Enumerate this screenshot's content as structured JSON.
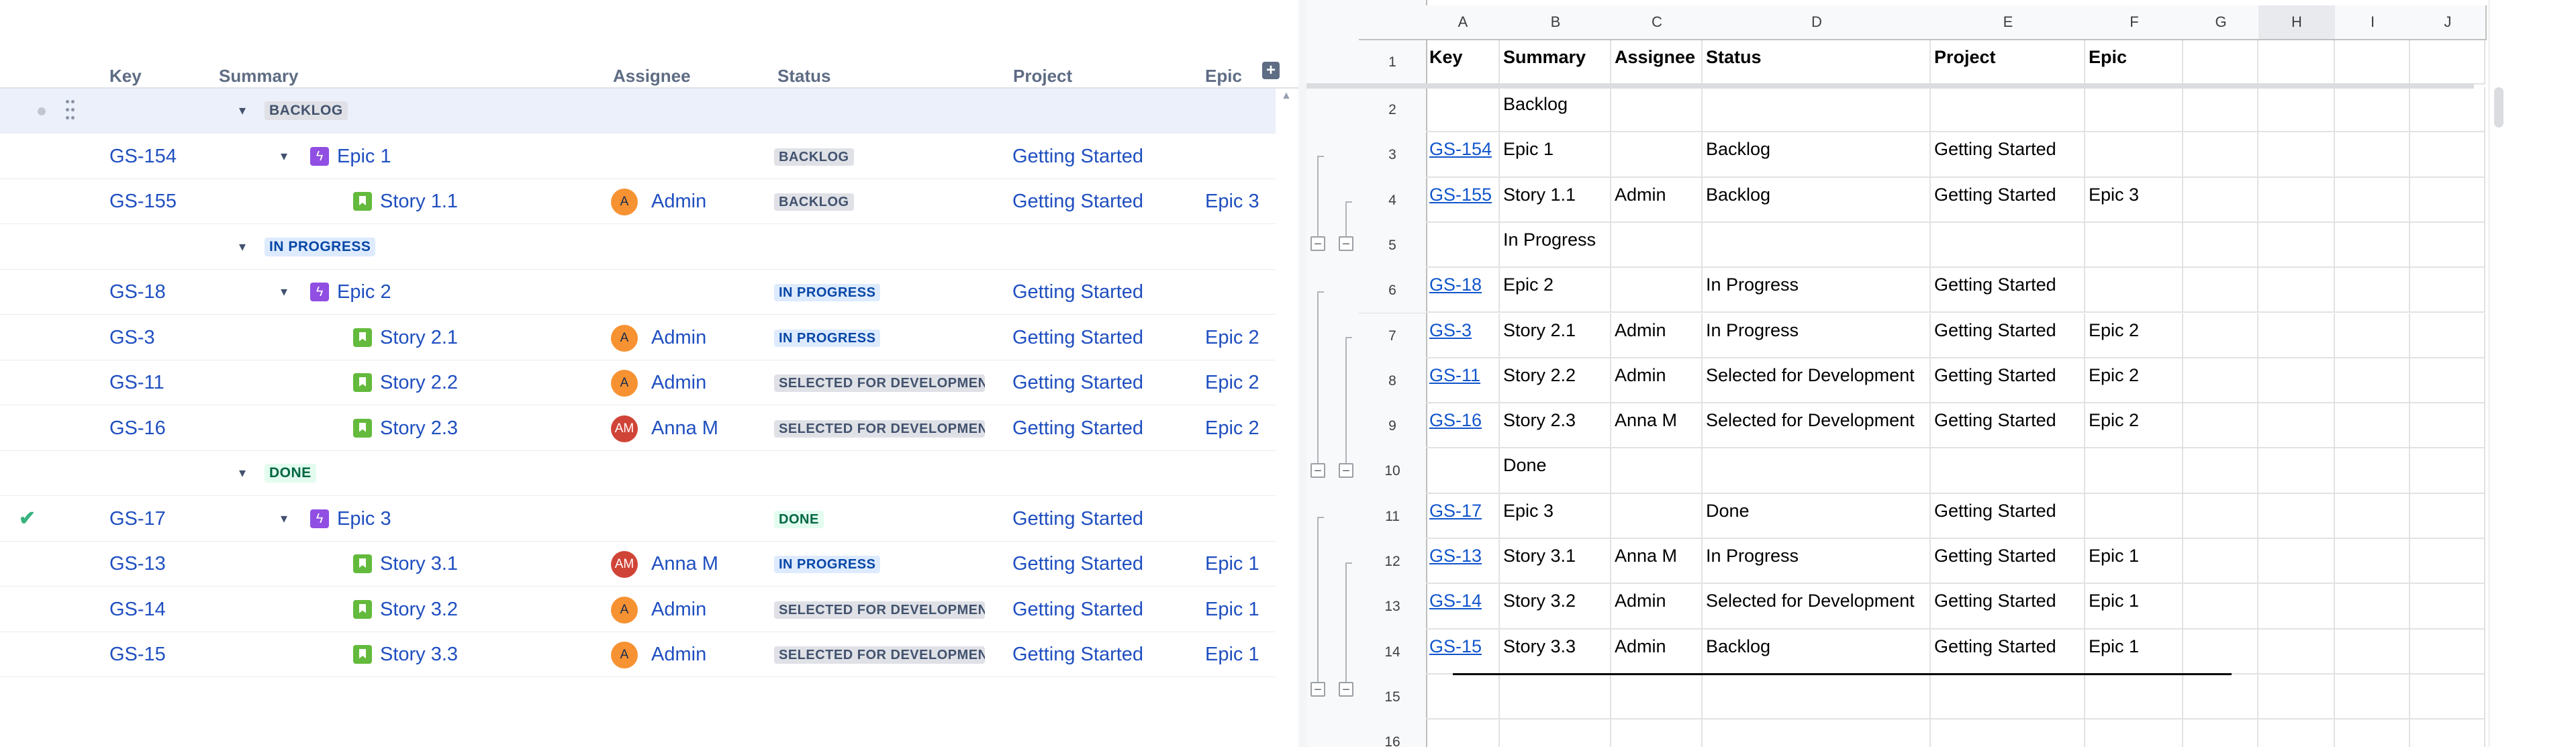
{
  "structure": {
    "columns": [
      "Key",
      "Summary",
      "Assignee",
      "Status",
      "Project",
      "Epic"
    ],
    "add_column_label": "+",
    "rows": [
      {
        "type": "group",
        "label": "BACKLOG",
        "color": "grey",
        "selected": true
      },
      {
        "type": "issue",
        "key": "GS-154",
        "issuetype": "epic",
        "expand": true,
        "summary": "Epic 1",
        "assignee": "",
        "avatar": "",
        "status": "BACKLOG",
        "status_color": "grey",
        "project": "Getting Started",
        "epic": ""
      },
      {
        "type": "issue",
        "key": "GS-155",
        "issuetype": "story",
        "expand": false,
        "summary": "Story 1.1",
        "assignee": "Admin",
        "avatar": "A",
        "status": "BACKLOG",
        "status_color": "grey",
        "project": "Getting Started",
        "epic": "Epic 3"
      },
      {
        "type": "group",
        "label": "IN PROGRESS",
        "color": "blue"
      },
      {
        "type": "issue",
        "key": "GS-18",
        "issuetype": "epic",
        "expand": true,
        "summary": "Epic 2",
        "assignee": "",
        "avatar": "",
        "status": "IN PROGRESS",
        "status_color": "blue",
        "project": "Getting Started",
        "epic": ""
      },
      {
        "type": "issue",
        "key": "GS-3",
        "issuetype": "story",
        "expand": false,
        "summary": "Story 2.1",
        "assignee": "Admin",
        "avatar": "A",
        "status": "IN PROGRESS",
        "status_color": "blue",
        "project": "Getting Started",
        "epic": "Epic 2"
      },
      {
        "type": "issue",
        "key": "GS-11",
        "issuetype": "story",
        "expand": false,
        "summary": "Story 2.2",
        "assignee": "Admin",
        "avatar": "A",
        "status": "SELECTED FOR DEVELOPMENT",
        "status_color": "grey",
        "project": "Getting Started",
        "epic": "Epic 2"
      },
      {
        "type": "issue",
        "key": "GS-16",
        "issuetype": "story",
        "expand": false,
        "summary": "Story 2.3",
        "assignee": "Anna M",
        "avatar": "AM",
        "status": "SELECTED FOR DEVELOPMENT",
        "status_color": "grey",
        "project": "Getting Started",
        "epic": "Epic 2"
      },
      {
        "type": "group",
        "label": "DONE",
        "color": "green"
      },
      {
        "type": "issue",
        "key": "GS-17",
        "issuetype": "epic",
        "expand": true,
        "resolved": true,
        "summary": "Epic 3",
        "assignee": "",
        "avatar": "",
        "status": "DONE",
        "status_color": "green",
        "project": "Getting Started",
        "epic": ""
      },
      {
        "type": "issue",
        "key": "GS-13",
        "issuetype": "story",
        "expand": false,
        "summary": "Story 3.1",
        "assignee": "Anna M",
        "avatar": "AM",
        "status": "IN PROGRESS",
        "status_color": "blue",
        "project": "Getting Started",
        "epic": "Epic 1"
      },
      {
        "type": "issue",
        "key": "GS-14",
        "issuetype": "story",
        "expand": false,
        "summary": "Story 3.2",
        "assignee": "Admin",
        "avatar": "A",
        "status": "SELECTED FOR DEVELOPMENT",
        "status_color": "grey",
        "project": "Getting Started",
        "epic": "Epic 1"
      },
      {
        "type": "issue",
        "key": "GS-15",
        "issuetype": "story",
        "expand": false,
        "summary": "Story 3.3",
        "assignee": "Admin",
        "avatar": "A",
        "status": "SELECTED FOR DEVELOPMENT",
        "status_color": "grey",
        "project": "Getting Started",
        "epic": "Epic 1"
      }
    ]
  },
  "sheet": {
    "column_letters": [
      "A",
      "B",
      "C",
      "D",
      "E",
      "F",
      "G",
      "H",
      "I",
      "J"
    ],
    "highlighted_column": "H",
    "row_numbers": [
      "1",
      "2",
      "3",
      "4",
      "5",
      "6",
      "7",
      "8",
      "9",
      "10",
      "11",
      "12",
      "13",
      "14",
      "15",
      "16"
    ],
    "rows": [
      [
        "Key",
        "Summary",
        "Assignee",
        "Status",
        "Project",
        "Epic"
      ],
      [
        "",
        "Backlog",
        "",
        "",
        "",
        ""
      ],
      [
        "GS-154",
        "Epic 1",
        "",
        "Backlog",
        "Getting Started",
        ""
      ],
      [
        "GS-155",
        "Story 1.1",
        "Admin",
        "Backlog",
        "Getting Started",
        "Epic 3"
      ],
      [
        "",
        "In Progress",
        "",
        "",
        "",
        ""
      ],
      [
        "GS-18",
        "Epic 2",
        "",
        "In Progress",
        "Getting Started",
        ""
      ],
      [
        "GS-3",
        "Story 2.1",
        "Admin",
        "In Progress",
        "Getting Started",
        "Epic 2"
      ],
      [
        "GS-11",
        "Story 2.2",
        "Admin",
        "Selected for Development",
        "Getting Started",
        "Epic 2"
      ],
      [
        "GS-16",
        "Story 2.3",
        "Anna M",
        "Selected for Development",
        "Getting Started",
        "Epic 2"
      ],
      [
        "",
        "Done",
        "",
        "",
        "",
        ""
      ],
      [
        "GS-17",
        "Epic 3",
        "",
        "Done",
        "Getting Started",
        ""
      ],
      [
        "GS-13",
        "Story 3.1",
        "Anna M",
        "In Progress",
        "Getting Started",
        "Epic 1"
      ],
      [
        "GS-14",
        "Story 3.2",
        "Admin",
        "Selected for Development",
        "Getting Started",
        "Epic 1"
      ],
      [
        "GS-15",
        "Story 3.3",
        "Admin",
        "Backlog",
        "Getting Started",
        "Epic 1"
      ],
      [
        "",
        "",
        "",
        "",
        "",
        ""
      ],
      [
        "",
        "",
        "",
        "",
        "",
        ""
      ]
    ],
    "group_toggle": "−"
  },
  "colors": {
    "link": "#1f4fc0",
    "sheet_link": "#1155cc",
    "epic": "#904ee2",
    "story": "#63ba3c",
    "avatar_admin": "#f79232",
    "avatar_anna": "#d04437"
  }
}
